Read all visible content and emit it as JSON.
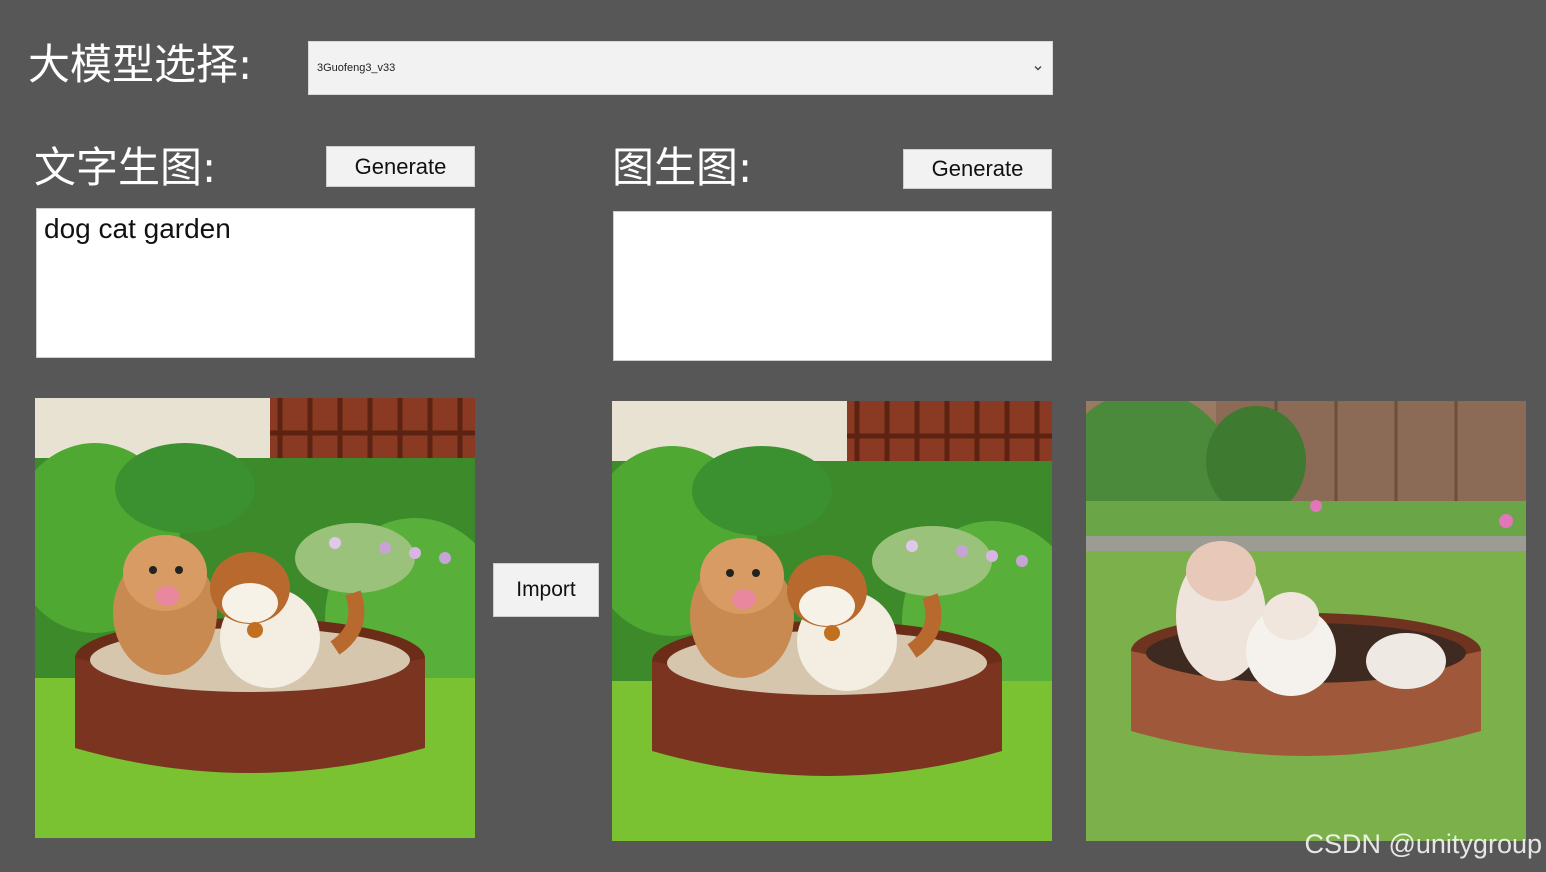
{
  "model": {
    "label": "大模型选择:",
    "selected": "3Guofeng3_v33"
  },
  "txt2img": {
    "label": "文字生图:",
    "generate_label": "Generate",
    "prompt_value": "dog cat garden"
  },
  "img2img": {
    "label": "图生图:",
    "generate_label": "Generate",
    "prompt_value": ""
  },
  "import_label": "Import",
  "watermark": "CSDN @unitygroup",
  "colors": {
    "background": "#575757",
    "control": "#f2f2f2",
    "field": "#ffffff"
  }
}
